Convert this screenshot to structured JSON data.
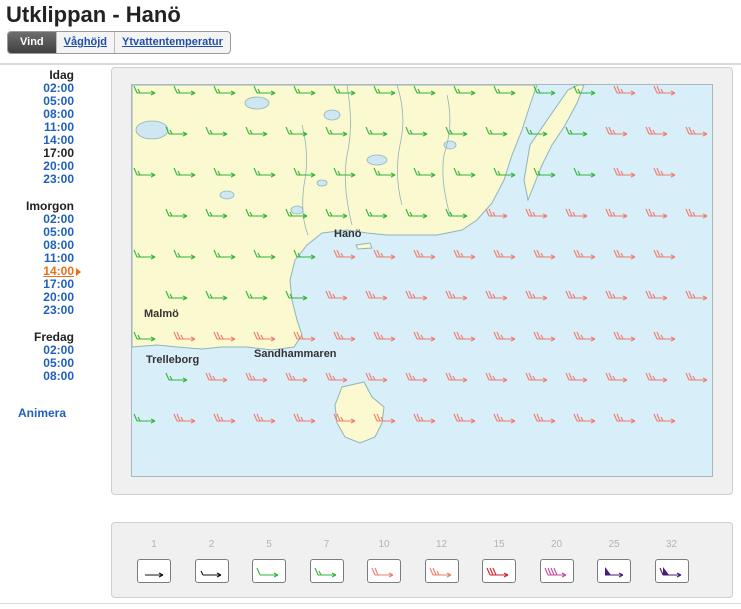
{
  "page": {
    "title": "Utklippan - Hanö",
    "tabs": [
      {
        "label": "Vind",
        "active": true
      },
      {
        "label": "Våghöjd",
        "active": false
      },
      {
        "label": "Ytvattentemperatur",
        "active": false
      }
    ]
  },
  "schedule": {
    "days": [
      {
        "label": "Idag",
        "times": [
          "02:00",
          "05:00",
          "08:00",
          "11:00",
          "14:00",
          "17:00",
          "20:00",
          "23:00"
        ]
      },
      {
        "label": "Imorgon",
        "times": [
          "02:00",
          "05:00",
          "08:00",
          "11:00",
          "14:00",
          "17:00",
          "20:00",
          "23:00"
        ]
      },
      {
        "label": "Fredag",
        "times": [
          "02:00",
          "05:00",
          "08:00"
        ]
      }
    ],
    "current": "Idag 17:00",
    "selected": "Imorgon 14:00",
    "animate_label": "Animera"
  },
  "map": {
    "places": [
      "Hanö",
      "Malmö",
      "Trelleborg",
      "Sandhammaren"
    ],
    "colors": {
      "sea": "#d8eef9",
      "land": "#fbf9cf",
      "coast": "#8fb4bd",
      "lake": "#cfe7f3"
    }
  },
  "legend": {
    "items": [
      {
        "speed": "1",
        "color": "#111111",
        "style": "arrow"
      },
      {
        "speed": "2",
        "color": "#111111",
        "style": "arrow-half"
      },
      {
        "speed": "5",
        "color": "#2fb53a",
        "style": "arrow-one"
      },
      {
        "speed": "7",
        "color": "#2fb53a",
        "style": "arrow-one-half"
      },
      {
        "speed": "10",
        "color": "#f07c6c",
        "style": "arrow-two"
      },
      {
        "speed": "12",
        "color": "#f07c6c",
        "style": "arrow-two-half"
      },
      {
        "speed": "15",
        "color": "#d61f2c",
        "style": "arrow-three"
      },
      {
        "speed": "20",
        "color": "#c24a9c",
        "style": "arrow-four"
      },
      {
        "speed": "25",
        "color": "#4a1b7a",
        "style": "arrow-flag"
      },
      {
        "speed": "32",
        "color": "#4a1b7a",
        "style": "arrow-flag-barb"
      }
    ]
  }
}
